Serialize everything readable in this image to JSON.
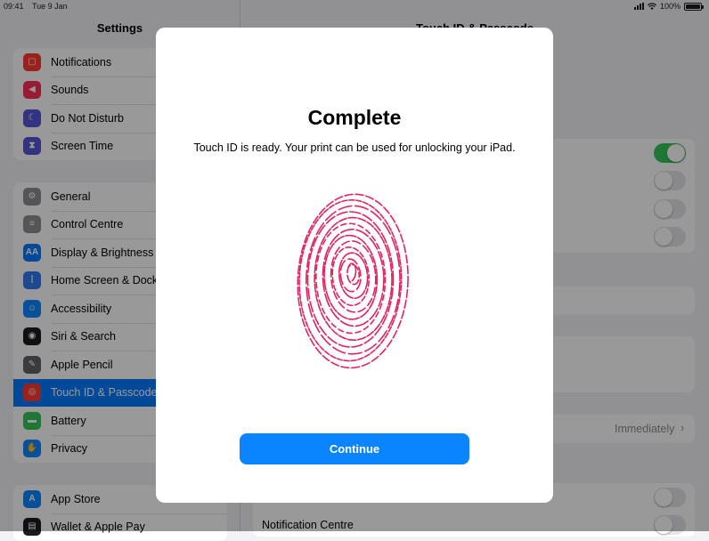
{
  "status_bar": {
    "time": "09:41",
    "date": "Tue 9 Jan",
    "battery": "100%"
  },
  "sidebar": {
    "title": "Settings",
    "group1": [
      {
        "label": "Notifications",
        "icon": "notifications-icon",
        "color": "#ff3b30"
      },
      {
        "label": "Sounds",
        "icon": "sounds-icon",
        "color": "#ff2d55"
      },
      {
        "label": "Do Not Disturb",
        "icon": "moon-icon",
        "color": "#5856d6"
      },
      {
        "label": "Screen Time",
        "icon": "hourglass-icon",
        "color": "#5856d6"
      }
    ],
    "group2": [
      {
        "label": "General",
        "icon": "gear-icon",
        "color": "#8e8e93"
      },
      {
        "label": "Control Centre",
        "icon": "control-centre-icon",
        "color": "#8e8e93"
      },
      {
        "label": "Display & Brightness",
        "icon": "display-icon",
        "color": "#007aff"
      },
      {
        "label": "Home Screen & Dock",
        "icon": "home-screen-icon",
        "color": "#3478f6"
      },
      {
        "label": "Accessibility",
        "icon": "accessibility-icon",
        "color": "#0a84ff"
      },
      {
        "label": "Siri & Search",
        "icon": "siri-icon",
        "color": "#1c1c1e"
      },
      {
        "label": "Apple Pencil",
        "icon": "pencil-icon",
        "color": "#636366"
      },
      {
        "label": "Touch ID & Passcode",
        "icon": "fingerprint-icon",
        "color": "#ff3b30",
        "selected": true
      },
      {
        "label": "Battery",
        "icon": "battery-icon",
        "color": "#34c759"
      },
      {
        "label": "Privacy",
        "icon": "hand-icon",
        "color": "#0a84ff"
      }
    ],
    "group3": [
      {
        "label": "App Store",
        "icon": "app-store-icon",
        "color": "#0a84ff"
      },
      {
        "label": "Wallet & Apple Pay",
        "icon": "wallet-icon",
        "color": "#1c1c1e"
      }
    ]
  },
  "detail": {
    "title": "Touch ID & Passcode",
    "require_passcode_value": "Immediately",
    "chevron": "›",
    "notification_centre_label": "Notification Centre"
  },
  "modal": {
    "title": "Complete",
    "message": "Touch ID is ready. Your print can be used for unlocking your iPad.",
    "continue_label": "Continue",
    "fingerprint_color": "#e0245e"
  }
}
